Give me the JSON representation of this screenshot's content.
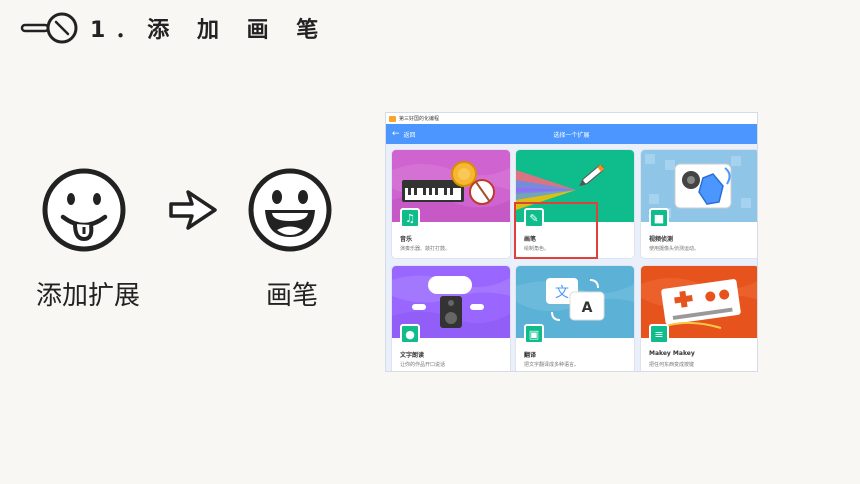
{
  "header": {
    "icon": "magnifier-icon",
    "title": "1．添 加 画 笔"
  },
  "left": {
    "face_icon": "tongue-smiley-icon",
    "caption": "添加扩展"
  },
  "arrow_icon": "right-arrow-outline-icon",
  "right": {
    "face_icon": "laughing-smiley-icon",
    "caption": "画笔"
  },
  "screenshot": {
    "app_title": "第三好国的化编程",
    "back_label": "返回",
    "nav_title": "选择一个扩展",
    "accent_color": "#4c97ff",
    "highlight_color": "#e0403a",
    "cards": [
      {
        "name": "音乐",
        "description": "演奏乐器、敲打打鼓。",
        "badge_icon": "music-notes-icon"
      },
      {
        "name": "画笔",
        "description": "绘制角色。",
        "badge_icon": "pen-icon"
      },
      {
        "name": "视频侦测",
        "description": "使用摄像头侦测运动。",
        "badge_icon": "video-camera-icon"
      },
      {
        "name": "文字朗读",
        "description": "让你的作品开口说话",
        "badge_icon": "speech-bubble-icon"
      },
      {
        "name": "翻译",
        "description": "把文字翻译成多种语言。",
        "badge_icon": "translate-icon"
      },
      {
        "name": "Makey Makey",
        "description": "把任何东西变成按键",
        "badge_icon": "makey-board-icon"
      }
    ]
  }
}
